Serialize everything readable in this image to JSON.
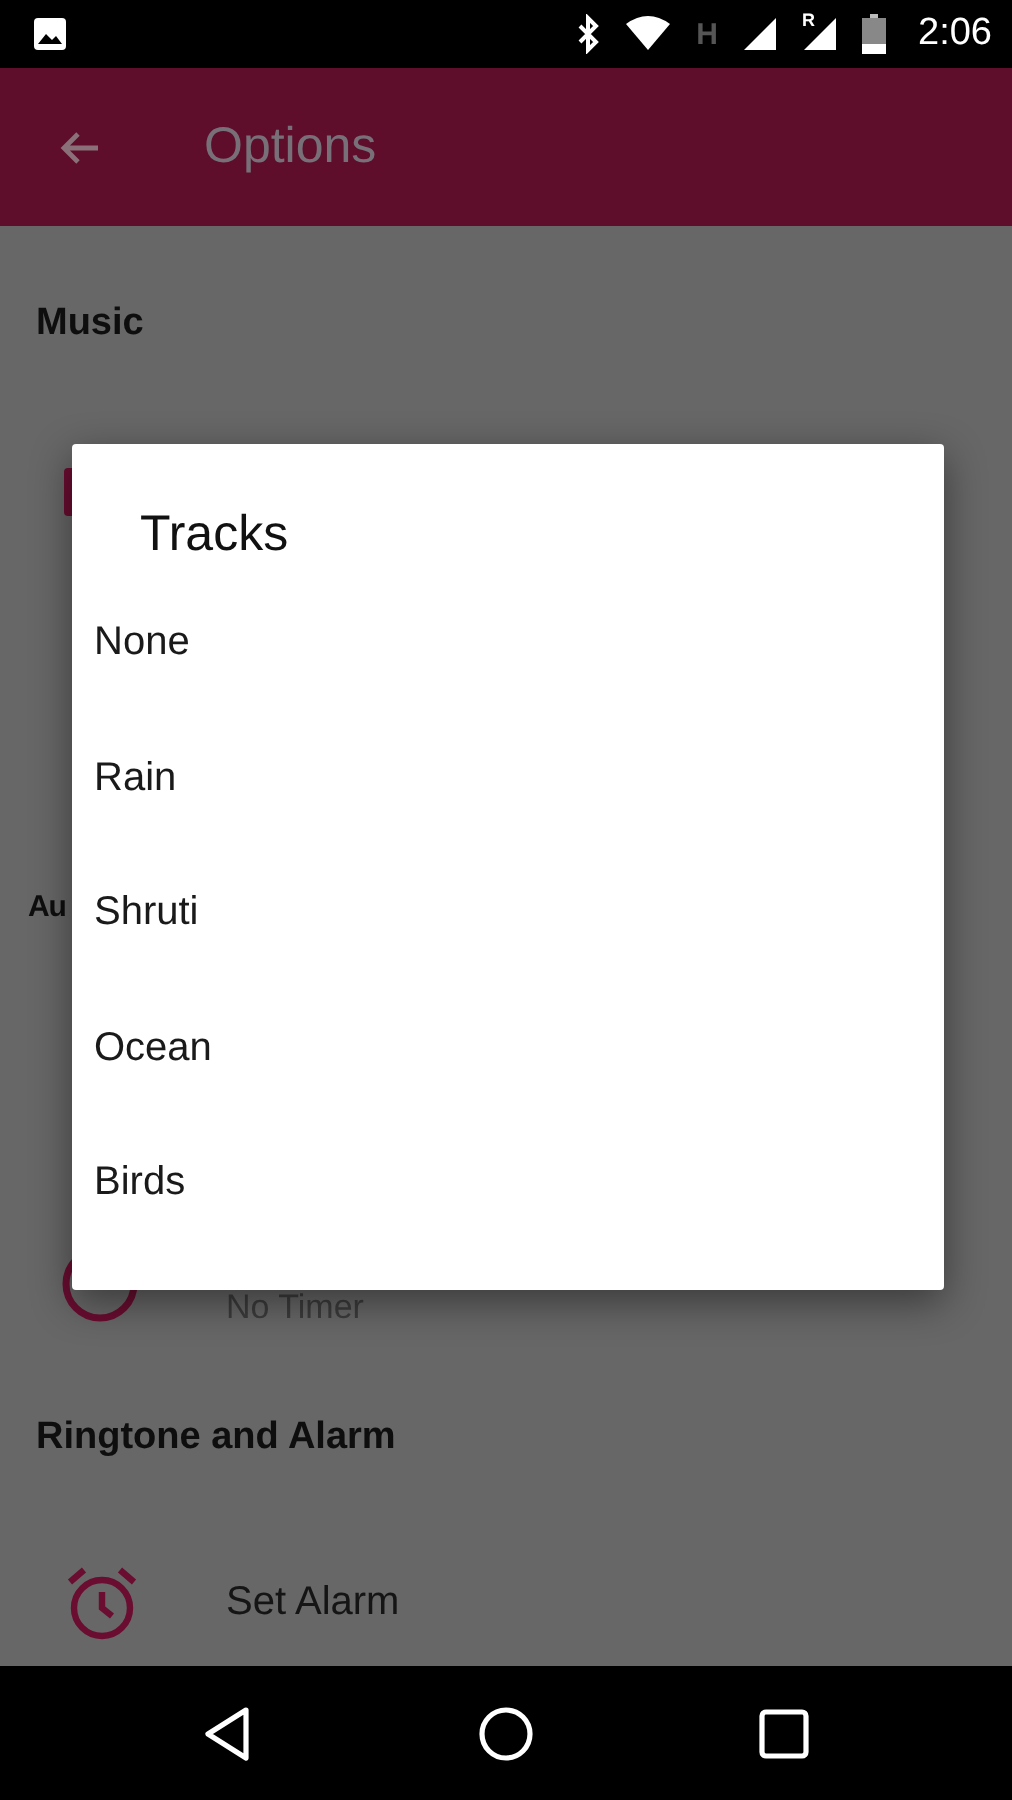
{
  "status_bar": {
    "network": "H",
    "roaming": "R",
    "time": "2:06"
  },
  "app_bar": {
    "title": "Options"
  },
  "sections": [
    {
      "header": "Music"
    },
    {
      "header": "Au",
      "subtitle": "No Timer"
    },
    {
      "header": "Ringtone and Alarm",
      "item": "Set Alarm"
    }
  ],
  "dialog": {
    "title": "Tracks",
    "items": [
      "None",
      "Rain",
      "Shruti",
      "Ocean",
      "Birds"
    ]
  }
}
